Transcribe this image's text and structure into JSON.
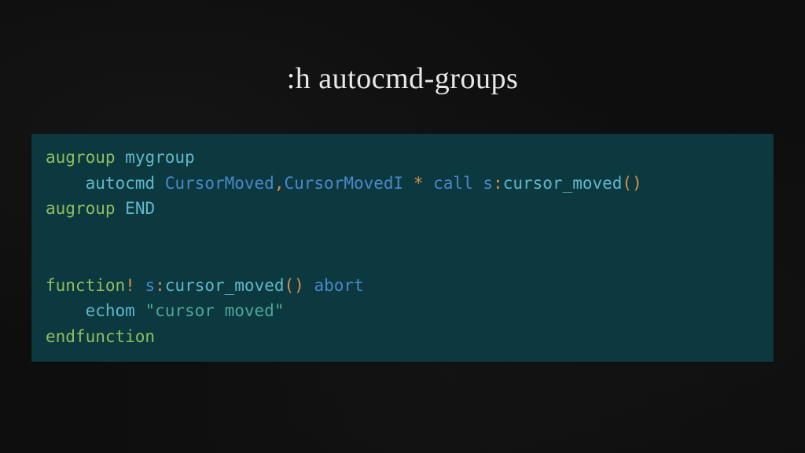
{
  "title": ":h autocmd-groups",
  "code": {
    "l1": {
      "kw": "augroup",
      "name": "mygroup"
    },
    "l2": {
      "indent": "    ",
      "autocmd": "autocmd",
      "ev1": "CursorMoved",
      "comma": ",",
      "ev2": "CursorMovedI",
      "star": " * ",
      "call": "call",
      "scope": "s",
      "colon": ":",
      "fn": "cursor_moved",
      "paren": "()"
    },
    "l3": {
      "kw": "augroup",
      "end": "END"
    },
    "l5": {
      "fn_kw": "function",
      "bang": "!",
      "scope": "s",
      "colon": ":",
      "fn": "cursor_moved",
      "paren": "()",
      "abort": "abort"
    },
    "l6": {
      "indent": "    ",
      "echom": "echom",
      "str": "\"cursor moved\""
    },
    "l7": {
      "endfn": "endfunction"
    }
  }
}
